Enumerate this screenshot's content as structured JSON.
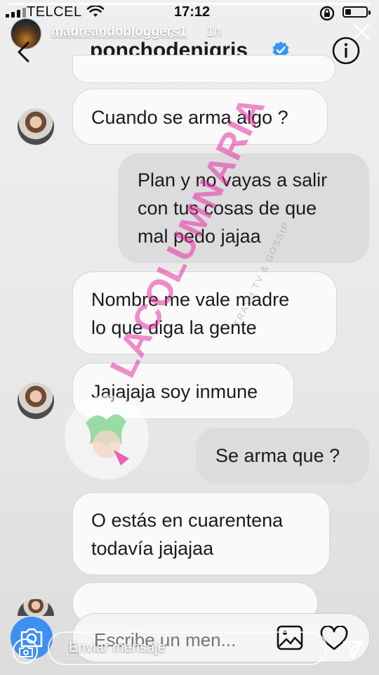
{
  "status_bar": {
    "carrier": "TELCEL",
    "time": "17:12"
  },
  "story": {
    "username": "madreandobloggers1",
    "time_ago": "1h",
    "progress": 1.0
  },
  "dm": {
    "title": "ponchodenigris",
    "verified": true
  },
  "messages": [
    {
      "id": "m1",
      "side": "in",
      "avatar": true,
      "lines": [
        "Cuando se arma algo ?"
      ]
    },
    {
      "id": "m2",
      "side": "out",
      "avatar": false,
      "lines": [
        "Plan y no vayas a salir",
        "con tus cosas de que",
        "mal pedo jajaa"
      ]
    },
    {
      "id": "m3",
      "side": "in",
      "avatar": false,
      "lines": [
        "Nombre me vale madre",
        "lo que diga la gente"
      ]
    },
    {
      "id": "m4",
      "side": "in",
      "avatar": true,
      "lines": [
        "Jajajaja soy inmune"
      ]
    },
    {
      "id": "m5",
      "side": "out",
      "avatar": false,
      "lines": [
        "Se arma que ?"
      ]
    },
    {
      "id": "m6",
      "side": "in",
      "avatar": false,
      "lines": [
        "O estás en cuarentena",
        "todavía jajajaa"
      ]
    }
  ],
  "watermark": {
    "text": "LACOLUMNARIA",
    "subtitle": "TRASH TV & GOSSIP"
  },
  "composer": {
    "placeholder": "Escribe un men..."
  },
  "reply": {
    "placeholder": "Enviar mensaje"
  },
  "icons": {
    "back": "chevron-left-icon",
    "verified": "verified-badge-icon",
    "info": "info-icon",
    "camera": "camera-icon",
    "gallery": "image-icon",
    "heart": "heart-icon",
    "send": "send-icon",
    "close": "close-icon"
  },
  "colors": {
    "accent": "#3d8ff0",
    "verified": "#3897f0",
    "watermark": "#e52fa0",
    "incoming_bg": "#fafafa",
    "outgoing_bg": "#dcdcde"
  }
}
